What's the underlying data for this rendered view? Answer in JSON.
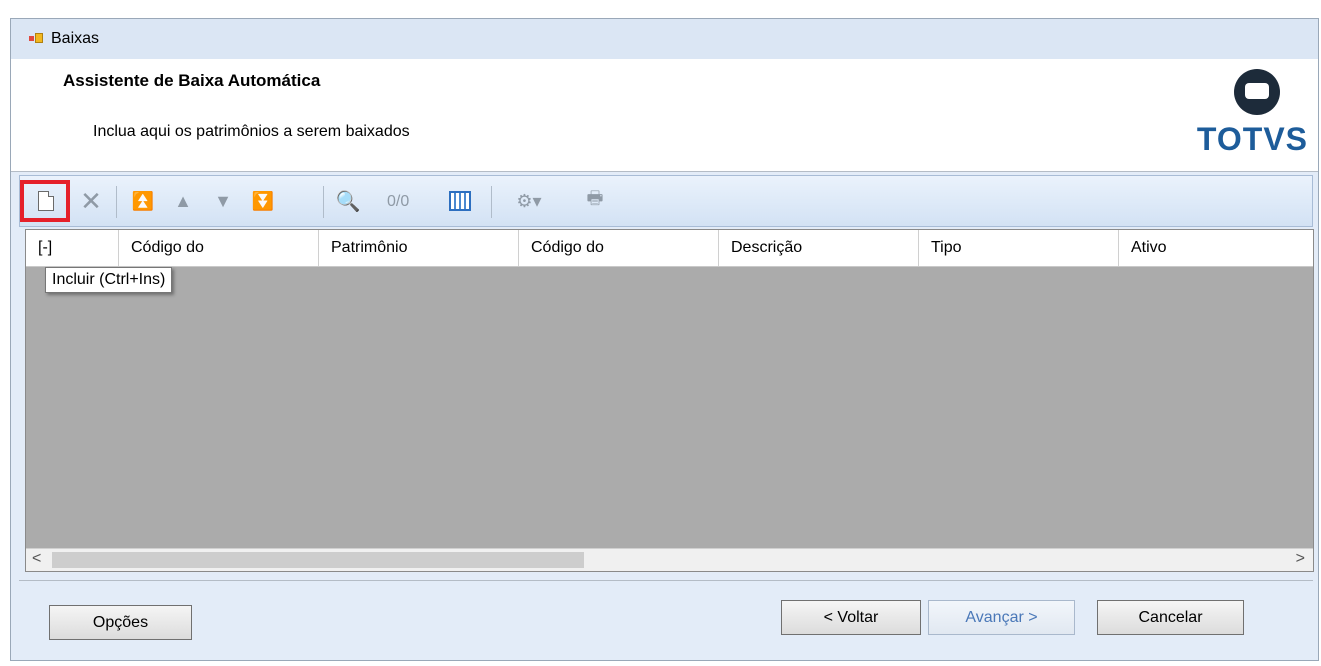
{
  "window": {
    "title": "Baixas"
  },
  "header": {
    "title": "Assistente de Baixa Automática",
    "subtitle": "Inclua aqui os patrimônios a serem baixados",
    "logo_text": "TOTVS"
  },
  "toolbar": {
    "counter": "0/0",
    "tooltip": "Incluir (Ctrl+Ins)"
  },
  "grid": {
    "columns": [
      "[-]",
      "Código do",
      "Patrimônio",
      "Código do",
      "Descrição",
      "Tipo",
      "Ativo"
    ]
  },
  "footer": {
    "options_label": "Opções",
    "back_label": "< Voltar",
    "next_label": "Avançar >",
    "cancel_label": "Cancelar"
  },
  "colors": {
    "highlight": "#e5202a",
    "logo_blue": "#1d5c9a",
    "grid_bg": "#ababab"
  }
}
